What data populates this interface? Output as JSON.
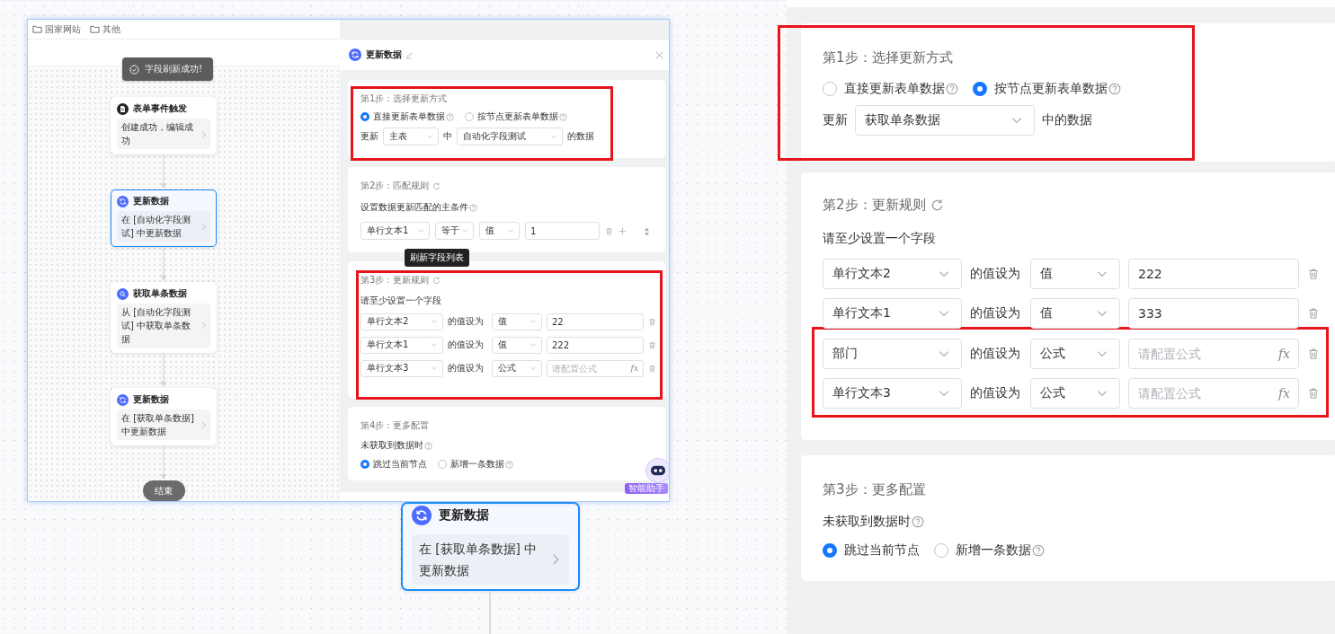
{
  "canvas_node": {
    "kind": "update",
    "title": "更新数据",
    "description": "在 [获取单条数据] 中更新数据",
    "selected": true
  },
  "embedded_screenshot": {
    "breadcrumbs": [
      "国家网站",
      "其他"
    ],
    "toast": "字段刷新成功!",
    "flow_nodes": [
      {
        "kind": "trigger",
        "title": "表单事件触发",
        "description": "创建成功，编辑成功",
        "selected": false
      },
      {
        "kind": "update",
        "title": "更新数据",
        "description": "在 [自动化字段测试] 中更新数据",
        "selected": true
      },
      {
        "kind": "query",
        "title": "获取单条数据",
        "description": "从 [自动化字段测试] 中获取单条数据",
        "selected": false
      },
      {
        "kind": "update",
        "title": "更新数据",
        "description": "在 [获取单条数据] 中更新数据",
        "selected": false
      }
    ],
    "end_button": "结束",
    "panel": {
      "kind": "update",
      "title": "更新数据",
      "sections": [
        {
          "kind": "mode",
          "title": "第1步：选择更新方式",
          "refresh": false,
          "highlighted": true,
          "options": [
            {
              "label": "直接更新表单数据",
              "selected": true,
              "help": true
            },
            {
              "label": "按节点更新表单数据",
              "selected": false,
              "help": true
            }
          ],
          "row": [
            {
              "kind": "text",
              "text": "更新"
            },
            {
              "kind": "select",
              "value": "主表"
            },
            {
              "kind": "text",
              "text": "中"
            },
            {
              "kind": "select",
              "value": "自动化字段测试"
            },
            {
              "kind": "text",
              "text": "的数据"
            }
          ]
        },
        {
          "kind": "match",
          "title": "第2步：匹配规则",
          "refresh": true,
          "highlighted": false,
          "subtitle": "设置数据更新匹配的主条件",
          "subtitle_help": true,
          "conditions": [
            {
              "field": "单行文本1",
              "operator": "等于",
              "value_type": "值",
              "value": "1"
            }
          ]
        },
        {
          "kind": "rules",
          "title": "第3步：更新规则",
          "refresh": true,
          "highlighted": true,
          "subtitle": "请至少设置一个字段",
          "rules": [
            {
              "field": "单行文本2",
              "connector": "的值设为",
              "value_type": "值",
              "value": "22",
              "highlighted": false
            },
            {
              "field": "单行文本1",
              "connector": "的值设为",
              "value_type": "值",
              "value": "222",
              "highlighted": false
            },
            {
              "field": "单行文本3",
              "connector": "的值设为",
              "value_type": "公式",
              "placeholder": "请配置公式",
              "formula_mark": "fx",
              "highlighted": false
            }
          ]
        },
        {
          "kind": "more",
          "title": "第4步：更多配置",
          "refresh": false,
          "highlighted": false,
          "subtitle": "未获取到数据时",
          "subtitle_help": true,
          "options": [
            {
              "label": "跳过当前节点",
              "selected": true,
              "help": false
            },
            {
              "label": "新增一条数据",
              "selected": false,
              "help": true
            }
          ]
        }
      ]
    },
    "tooltip": "刷新字段列表",
    "assistant_label": "智能助手"
  },
  "settings_panel": {
    "sections": [
      {
        "kind": "mode",
        "title": "第1步：选择更新方式",
        "refresh": false,
        "highlighted": true,
        "options": [
          {
            "label": "直接更新表单数据",
            "selected": false,
            "help": true
          },
          {
            "label": "按节点更新表单数据",
            "selected": true,
            "help": true
          }
        ],
        "row": [
          {
            "kind": "text",
            "text": "更新"
          },
          {
            "kind": "select",
            "value": "获取单条数据"
          },
          {
            "kind": "text",
            "text": "中的数据"
          }
        ]
      },
      {
        "kind": "rules",
        "title": "第2步：更新规则",
        "refresh": true,
        "highlighted": false,
        "subtitle": "请至少设置一个字段",
        "rules": [
          {
            "field": "单行文本2",
            "connector": "的值设为",
            "value_type": "值",
            "value": "222",
            "highlighted": false
          },
          {
            "field": "单行文本1",
            "connector": "的值设为",
            "value_type": "值",
            "value": "333",
            "highlighted": false
          },
          {
            "field": "部门",
            "connector": "的值设为",
            "value_type": "公式",
            "placeholder": "请配置公式",
            "formula_mark": "fx",
            "highlighted": true
          },
          {
            "field": "单行文本3",
            "connector": "的值设为",
            "value_type": "公式",
            "placeholder": "请配置公式",
            "formula_mark": "fx",
            "highlighted": true
          }
        ]
      },
      {
        "kind": "more",
        "title": "第3步：更多配置",
        "refresh": false,
        "highlighted": false,
        "subtitle": "未获取到数据时",
        "subtitle_help": true,
        "options": [
          {
            "label": "跳过当前节点",
            "selected": true,
            "help": false
          },
          {
            "label": "新增一条数据",
            "selected": false,
            "help": true
          }
        ]
      }
    ]
  }
}
